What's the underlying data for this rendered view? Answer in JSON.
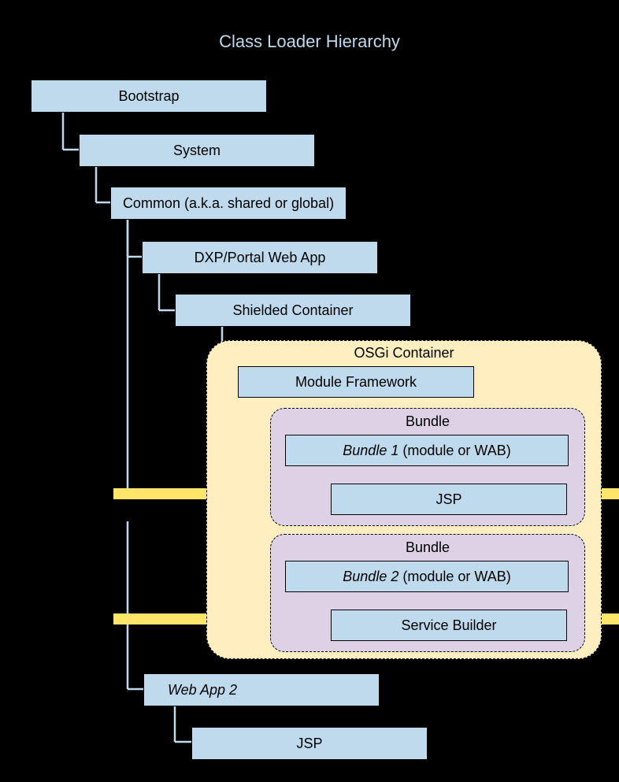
{
  "title": "Class Loader Hierarchy",
  "nodes": {
    "bootstrap": "Bootstrap",
    "system": "System",
    "common": "Common (a.k.a. shared or global)",
    "dxp_portal": "DXP/Portal Web App",
    "shielded": "Shielded Container",
    "osgi_container_title": "OSGi Container",
    "module_framework": "Module Framework",
    "bundle1_title": "Bundle",
    "bundle1_label": "Bundle 1",
    "bundle1_suffix": " (module or WAB)",
    "jsp1": "JSP",
    "bundle2_title": "Bundle",
    "bundle2_label": "Bundle 2",
    "bundle2_suffix": " (module or WAB)",
    "service_builder": "Service Builder",
    "web_app2": "Web App 2",
    "jsp2": "JSP"
  }
}
